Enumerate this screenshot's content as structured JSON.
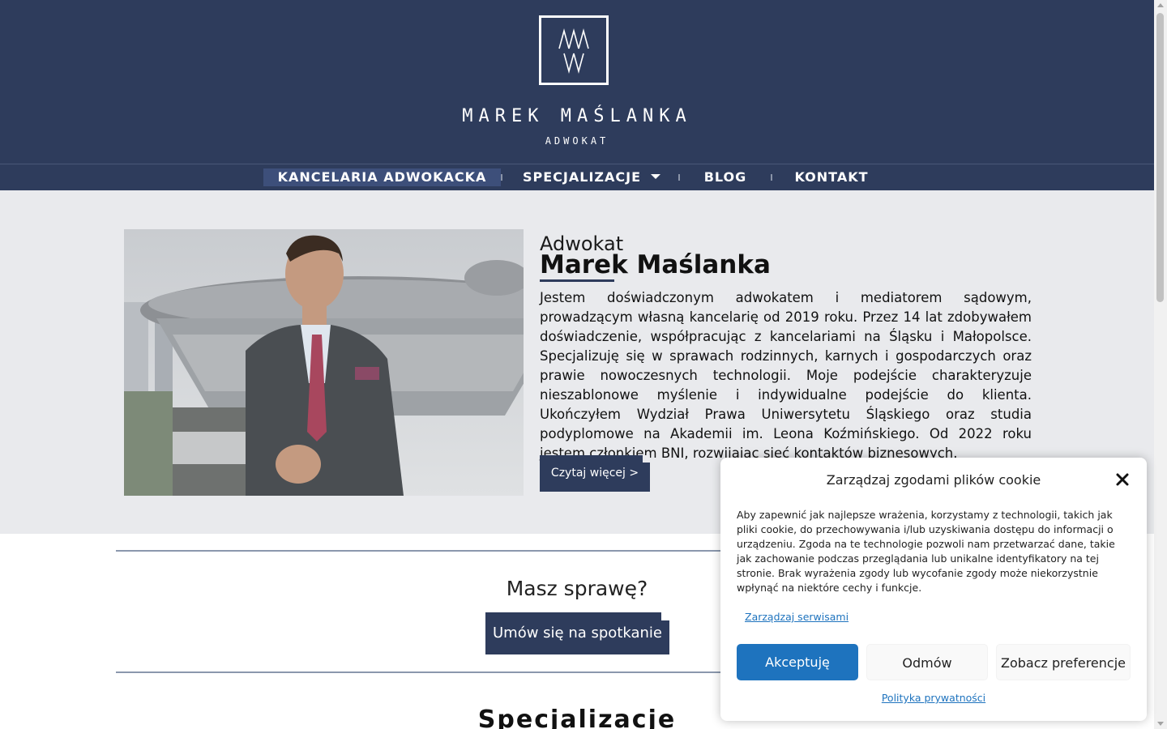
{
  "header": {
    "brand_name": "MAREK MAŚLANKA",
    "brand_sub": "ADWOKAT",
    "colors": {
      "primary": "#2e3c5c",
      "accent": "#1e73be"
    }
  },
  "nav": {
    "items": [
      {
        "label": "KANCELARIA ADWOKACKA",
        "active": true
      },
      {
        "label": "SPECJALIZACJE",
        "has_dropdown": true
      },
      {
        "label": "BLOG"
      },
      {
        "label": "KONTAKT"
      }
    ]
  },
  "hero": {
    "pre_title": "Adwokat",
    "title": "Marek Maślanka",
    "text": "Jestem doświadczonym adwokatem i mediatorem sądowym, prowadzącym własną kancelarię od 2019 roku. Przez 14 lat zdobywałem doświadczenie, współpracując z kancelariami na Śląsku i Małopolsce. Specjalizuję się w sprawach rodzinnych, karnych i gospodarczych oraz prawie nowoczesnych technologii. Moje podejście charakteryzuje nieszablonowe myślenie i indywidualne podejście do klienta. Ukończyłem Wydział Prawa Uniwersytetu Śląskiego oraz studia podyplomowe na Akademii im. Leona Koźmińskiego. Od 2022 roku jestem członkiem BNI, rozwijając sieć kontaktów biznesowych.",
    "read_more": "Czytaj więcej >"
  },
  "case": {
    "title": "Masz sprawę?",
    "button": "Umów się na spotkanie"
  },
  "specializations": {
    "title": "Specjalizacje"
  },
  "cookie": {
    "title": "Zarządzaj zgodami plików cookie",
    "text": "Aby zapewnić jak najlepsze wrażenia, korzystamy z technologii, takich jak pliki cookie, do przechowywania i/lub uzyskiwania dostępu do informacji o urządzeniu. Zgoda na te technologie pozwoli nam przetwarzać dane, takie jak zachowanie podczas przeglądania lub unikalne identyfikatory na tej stronie. Brak wyrażenia zgody lub wycofanie zgody może niekorzystnie wpłynąć na niektóre cechy i funkcje.",
    "manage_services": "Zarządzaj serwisami",
    "accept": "Akceptuję",
    "deny": "Odmów",
    "preferences": "Zobacz preferencje",
    "privacy_policy": "Polityka prywatności"
  }
}
